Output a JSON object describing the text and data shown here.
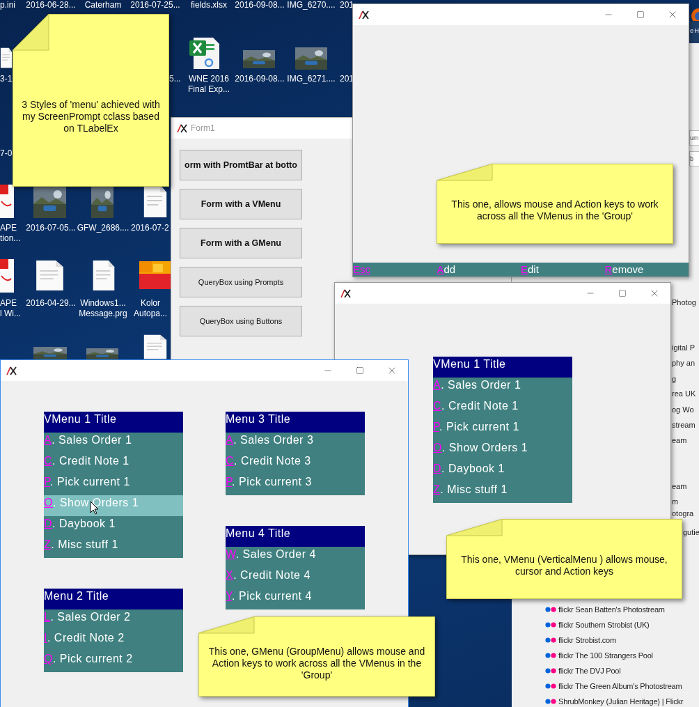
{
  "desktop_icons": [
    {
      "label": "p.ini"
    },
    {
      "label": "2016-06-28..."
    },
    {
      "label": "Caterham"
    },
    {
      "label": "2016-07-25..."
    },
    {
      "label": "fields.xlsx"
    },
    {
      "label": "2016-09-08..."
    },
    {
      "label": "IMG_6270...."
    },
    {
      "label": "201"
    },
    {
      "label": "3-1",
      "kind": "document"
    },
    {
      "label": "5..."
    },
    {
      "label": "WNE 2016\nFinal Exp...",
      "kind": "spreadsheet"
    },
    {
      "label": "2016-09-08...",
      "kind": "picture"
    },
    {
      "label": "IMG_6271....",
      "kind": "picture"
    },
    {
      "label": "201"
    },
    {
      "label": "7-0"
    },
    {
      "label": "APE\ntion...",
      "kind": "pdf"
    },
    {
      "label": "2016-07-05...",
      "kind": "picture"
    },
    {
      "label": "GFW_2686....",
      "kind": "picture"
    },
    {
      "label": "2016-07-2",
      "kind": "document"
    },
    {
      "label": "APE\nl Wi...",
      "kind": "pdf"
    },
    {
      "label": "2016-04-29...",
      "kind": "document"
    },
    {
      "label": "Windows1...\nMessage.prg",
      "kind": "document"
    },
    {
      "label": "Kolor\nAutopa...",
      "kind": "app"
    }
  ],
  "browser": {
    "tab_text": "e H",
    "fields": [
      "um",
      "b"
    ],
    "fragments": [
      "Photog",
      "igital P",
      "phy an",
      "g",
      "rea UK",
      "og  Wo",
      "stream",
      "eam",
      "eam",
      "m",
      "otogra",
      "gutie"
    ],
    "links": [
      "flickr Sean Batten's Photostream",
      "flickr Southern Strobist (UK)",
      "flickr Strobist.com",
      "flickr The 100 Strangers Pool",
      "flickr The DVJ Pool",
      "flickr The Green Album's Photostream",
      "ShrubMonkey (Julian Heritage) | Flickr"
    ]
  },
  "form1": {
    "title": "Form1",
    "buttons": [
      {
        "label": "orm with PromtBar at botto",
        "kind": "bold"
      },
      {
        "label": "Form with a VMenu",
        "kind": "bold"
      },
      {
        "label": "Form with a GMenu",
        "kind": "bold"
      },
      {
        "label": "QueryBox using Prompts",
        "kind": "plain"
      },
      {
        "label": "QueryBox using Buttons",
        "kind": "plain"
      }
    ]
  },
  "promptbar_window": {
    "prompt_bar": [
      {
        "hotkey": "Esc"
      },
      {
        "hotkey": "A",
        "rest": "dd"
      },
      {
        "hotkey": "E",
        "rest": "dit"
      },
      {
        "hotkey": "R",
        "rest": "emove"
      }
    ]
  },
  "vmenu_window": {
    "menu": {
      "title": "VMenu 1 Title",
      "items": [
        {
          "hotkey": "A",
          "label": ". Sales Order 1",
          "selected": false
        },
        {
          "hotkey": "C",
          "label": ". Credit Note 1",
          "selected": false
        },
        {
          "hotkey": "P",
          "label": ". Pick current 1",
          "selected": false
        },
        {
          "hotkey": "O",
          "label": ". Show Orders 1",
          "selected": false
        },
        {
          "hotkey": "D",
          "label": ". Daybook 1",
          "selected": false
        },
        {
          "hotkey": "Z",
          "label": ". Misc stuff 1",
          "selected": false
        }
      ]
    }
  },
  "gmenu_window": {
    "menus": [
      {
        "title": "VMenu 1 Title",
        "items": [
          {
            "hotkey": "A",
            "label": ". Sales Order 1",
            "selected": false
          },
          {
            "hotkey": "C",
            "label": ". Credit Note 1",
            "selected": false
          },
          {
            "hotkey": "P",
            "label": ". Pick current 1",
            "selected": false
          },
          {
            "hotkey": "O",
            "label": ". Show Orders 1",
            "selected": true
          },
          {
            "hotkey": "D",
            "label": ". Daybook 1",
            "selected": false
          },
          {
            "hotkey": "Z",
            "label": ". Misc stuff 1",
            "selected": false
          }
        ]
      },
      {
        "title": "Menu 3 Title",
        "items": [
          {
            "hotkey": "A",
            "label": ". Sales Order 3",
            "selected": false
          },
          {
            "hotkey": "C",
            "label": ". Credit Note 3",
            "selected": false
          },
          {
            "hotkey": "P",
            "label": ". Pick current 3",
            "selected": false
          }
        ]
      },
      {
        "title": "Menu 4 Title",
        "items": [
          {
            "hotkey": "W",
            "label": ". Sales Order 4",
            "selected": false
          },
          {
            "hotkey": "X",
            "label": ". Credit Note 4",
            "selected": false
          },
          {
            "hotkey": "Y",
            "label": ". Pick current 4",
            "selected": false
          }
        ]
      },
      {
        "title": "Menu 2 Title",
        "items": [
          {
            "hotkey": "L",
            "label": ". Sales Order 2",
            "selected": false
          },
          {
            "hotkey": "I",
            "label": ". Credit Note 2",
            "selected": false
          },
          {
            "hotkey": "Q",
            "label": ". Pick current 2",
            "selected": false
          }
        ]
      }
    ]
  },
  "notes": [
    "3 Styles of 'menu' achieved with my ScreenPrompt cclass based on TLabelEx",
    "This one, allows mouse and Action keys to work across all the VMenus in the 'Group'",
    "This one, VMenu (VerticalMenu ) allows mouse, cursor and Action keys",
    "This one, GMenu (GroupMenu) allows mouse and Action keys to work across all the VMenus in the 'Group'"
  ]
}
